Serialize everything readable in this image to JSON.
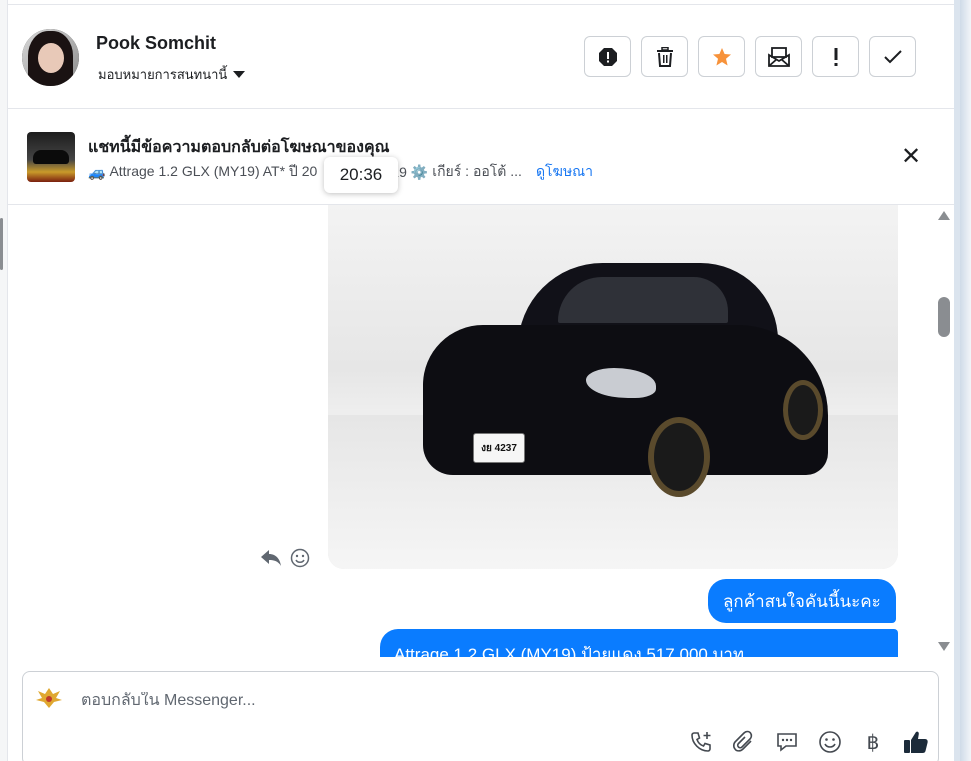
{
  "contact": {
    "name": "Pook Somchit",
    "assign_label": "มอบหมายการสนทนานี้"
  },
  "actions": [
    {
      "name": "spam",
      "icon": "alert-octagon-icon"
    },
    {
      "name": "delete",
      "icon": "trash-icon"
    },
    {
      "name": "star",
      "icon": "star-icon",
      "color": "#f7923a"
    },
    {
      "name": "mark-unread",
      "icon": "envelope-icon"
    },
    {
      "name": "follow-up",
      "icon": "exclamation-icon"
    },
    {
      "name": "mark-done",
      "icon": "check-icon"
    }
  ],
  "ad_banner": {
    "title": "แชทนี้มีข้อความตอบกลับต่อโฆษณาของคุณ",
    "subtitle_car_emoji": "🚙",
    "subtitle_text": "Attrage 1.2 GLX (MY19) AT* ปี 20",
    "subtitle_text_2": "19",
    "subtitle_gear_emoji": "⚙️",
    "subtitle_gear_text": "เกียร์ : ออโต้ ...",
    "view_ad_link": "ดูโฆษณา"
  },
  "tooltip": {
    "time": "20:36"
  },
  "photo": {
    "plate": "งย 4237"
  },
  "messages": [
    {
      "direction": "outgoing",
      "text": "ลูกค้าสนใจคันนี้นะคะ"
    },
    {
      "direction": "outgoing",
      "text": "Attrage 1.2 GLX (MY19) ป้ายแดง 517,000 บาท"
    }
  ],
  "composer": {
    "placeholder": "ตอบกลับใน Messenger...",
    "currency_symbol": "฿"
  },
  "colors": {
    "accent": "#0a7cff",
    "star": "#f7923a",
    "link": "#1877f2"
  }
}
